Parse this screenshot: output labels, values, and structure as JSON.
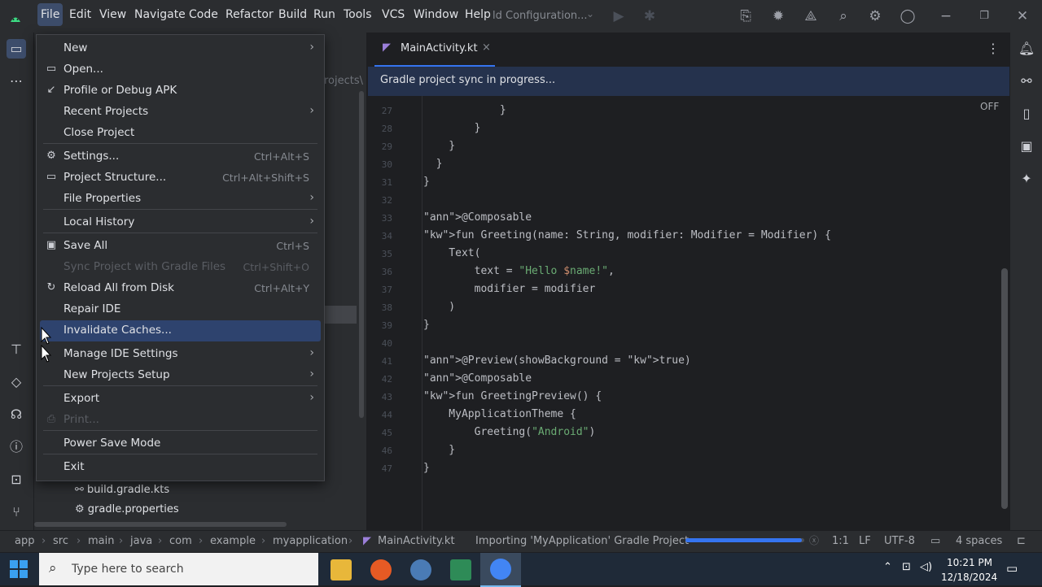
{
  "menubar": [
    "File",
    "Edit",
    "View",
    "Navigate",
    "Code",
    "Refactor",
    "Build",
    "Run",
    "Tools",
    "VCS",
    "Window",
    "Help"
  ],
  "run_config": "ld Configuration...",
  "tab": {
    "label": "MainActivity.kt",
    "close": "×"
  },
  "banner": "Gradle project sync in progress...",
  "inlay_hint": "OFF",
  "breadcrumb_bg": "rojects\\",
  "code_lines": [
    {
      "n": "27",
      "t": "            }"
    },
    {
      "n": "28",
      "t": "        }"
    },
    {
      "n": "29",
      "t": "    }"
    },
    {
      "n": "30",
      "t": "  }"
    },
    {
      "n": "31",
      "t": "}"
    },
    {
      "n": "32",
      "t": ""
    },
    {
      "n": "33",
      "t": "@Composable"
    },
    {
      "n": "34",
      "t": "fun Greeting(name: String, modifier: Modifier = Modifier) {"
    },
    {
      "n": "35",
      "t": "    Text("
    },
    {
      "n": "36",
      "t": "        text = \"Hello $name!\","
    },
    {
      "n": "37",
      "t": "        modifier = modifier"
    },
    {
      "n": "38",
      "t": "    )"
    },
    {
      "n": "39",
      "t": "}"
    },
    {
      "n": "40",
      "t": ""
    },
    {
      "n": "41",
      "t": "@Preview(showBackground = true)"
    },
    {
      "n": "42",
      "t": "@Composable"
    },
    {
      "n": "43",
      "t": "fun GreetingPreview() {"
    },
    {
      "n": "44",
      "t": "    MyApplicationTheme {"
    },
    {
      "n": "45",
      "t": "        Greeting(\"Android\")"
    },
    {
      "n": "46",
      "t": "    }"
    },
    {
      "n": "47",
      "t": "}"
    }
  ],
  "file_menu": [
    {
      "label": "New",
      "shortcut": "",
      "arrow": true,
      "icon": "",
      "disabled": false
    },
    {
      "label": "Open...",
      "shortcut": "",
      "arrow": false,
      "icon": "folder-icon",
      "disabled": false
    },
    {
      "label": "Profile or Debug APK",
      "shortcut": "",
      "arrow": false,
      "icon": "profile-apk-icon",
      "disabled": false
    },
    {
      "label": "Recent Projects",
      "shortcut": "",
      "arrow": true,
      "icon": "",
      "disabled": false
    },
    {
      "label": "Close Project",
      "shortcut": "",
      "arrow": false,
      "icon": "",
      "disabled": false
    },
    {
      "label": "Settings...",
      "shortcut": "Ctrl+Alt+S",
      "arrow": false,
      "icon": "gear-icon",
      "disabled": false
    },
    {
      "label": "Project Structure...",
      "shortcut": "Ctrl+Alt+Shift+S",
      "arrow": false,
      "icon": "folder-icon",
      "disabled": false
    },
    {
      "label": "File Properties",
      "shortcut": "",
      "arrow": true,
      "icon": "",
      "disabled": false
    },
    {
      "label": "Local History",
      "shortcut": "",
      "arrow": true,
      "icon": "",
      "disabled": false
    },
    {
      "label": "Save All",
      "shortcut": "Ctrl+S",
      "arrow": false,
      "icon": "save-icon",
      "disabled": false
    },
    {
      "label": "Sync Project with Gradle Files",
      "shortcut": "Ctrl+Shift+O",
      "arrow": false,
      "icon": "",
      "disabled": true
    },
    {
      "label": "Reload All from Disk",
      "shortcut": "Ctrl+Alt+Y",
      "arrow": false,
      "icon": "reload-icon",
      "disabled": false
    },
    {
      "label": "Repair IDE",
      "shortcut": "",
      "arrow": false,
      "icon": "",
      "disabled": false
    },
    {
      "label": "Invalidate Caches...",
      "shortcut": "",
      "arrow": false,
      "icon": "",
      "disabled": false,
      "highlighted": true
    },
    {
      "label": "Manage IDE Settings",
      "shortcut": "",
      "arrow": true,
      "icon": "",
      "disabled": false
    },
    {
      "label": "New Projects Setup",
      "shortcut": "",
      "arrow": true,
      "icon": "",
      "disabled": false
    },
    {
      "label": "Export",
      "shortcut": "",
      "arrow": true,
      "icon": "",
      "disabled": false
    },
    {
      "label": "Print...",
      "shortcut": "",
      "arrow": false,
      "icon": "print-icon",
      "disabled": true
    },
    {
      "label": "Power Save Mode",
      "shortcut": "",
      "arrow": false,
      "icon": "",
      "disabled": false
    },
    {
      "label": "Exit",
      "shortcut": "",
      "arrow": false,
      "icon": "",
      "disabled": false
    }
  ],
  "tree": [
    {
      "label": "build.gradle.kts",
      "icon": "gradle-icon"
    },
    {
      "label": "gradle.properties",
      "icon": "gear-icon"
    }
  ],
  "status": {
    "breadcrumbs": [
      "app",
      "src",
      "main",
      "java",
      "com",
      "example",
      "myapplication",
      "MainActivity.kt"
    ],
    "task": "Importing 'MyApplication' Gradle Project",
    "progress": 0.98,
    "position": "1:1",
    "line_sep": "LF",
    "encoding": "UTF-8",
    "indent": "4 spaces"
  },
  "taskbar": {
    "search_placeholder": "Type here to search",
    "time": "10:21 PM",
    "date": "12/18/2024"
  },
  "colors": {
    "accent": "#3574f0",
    "menu_highlight": "#2e436e",
    "banner": "#25324d"
  }
}
